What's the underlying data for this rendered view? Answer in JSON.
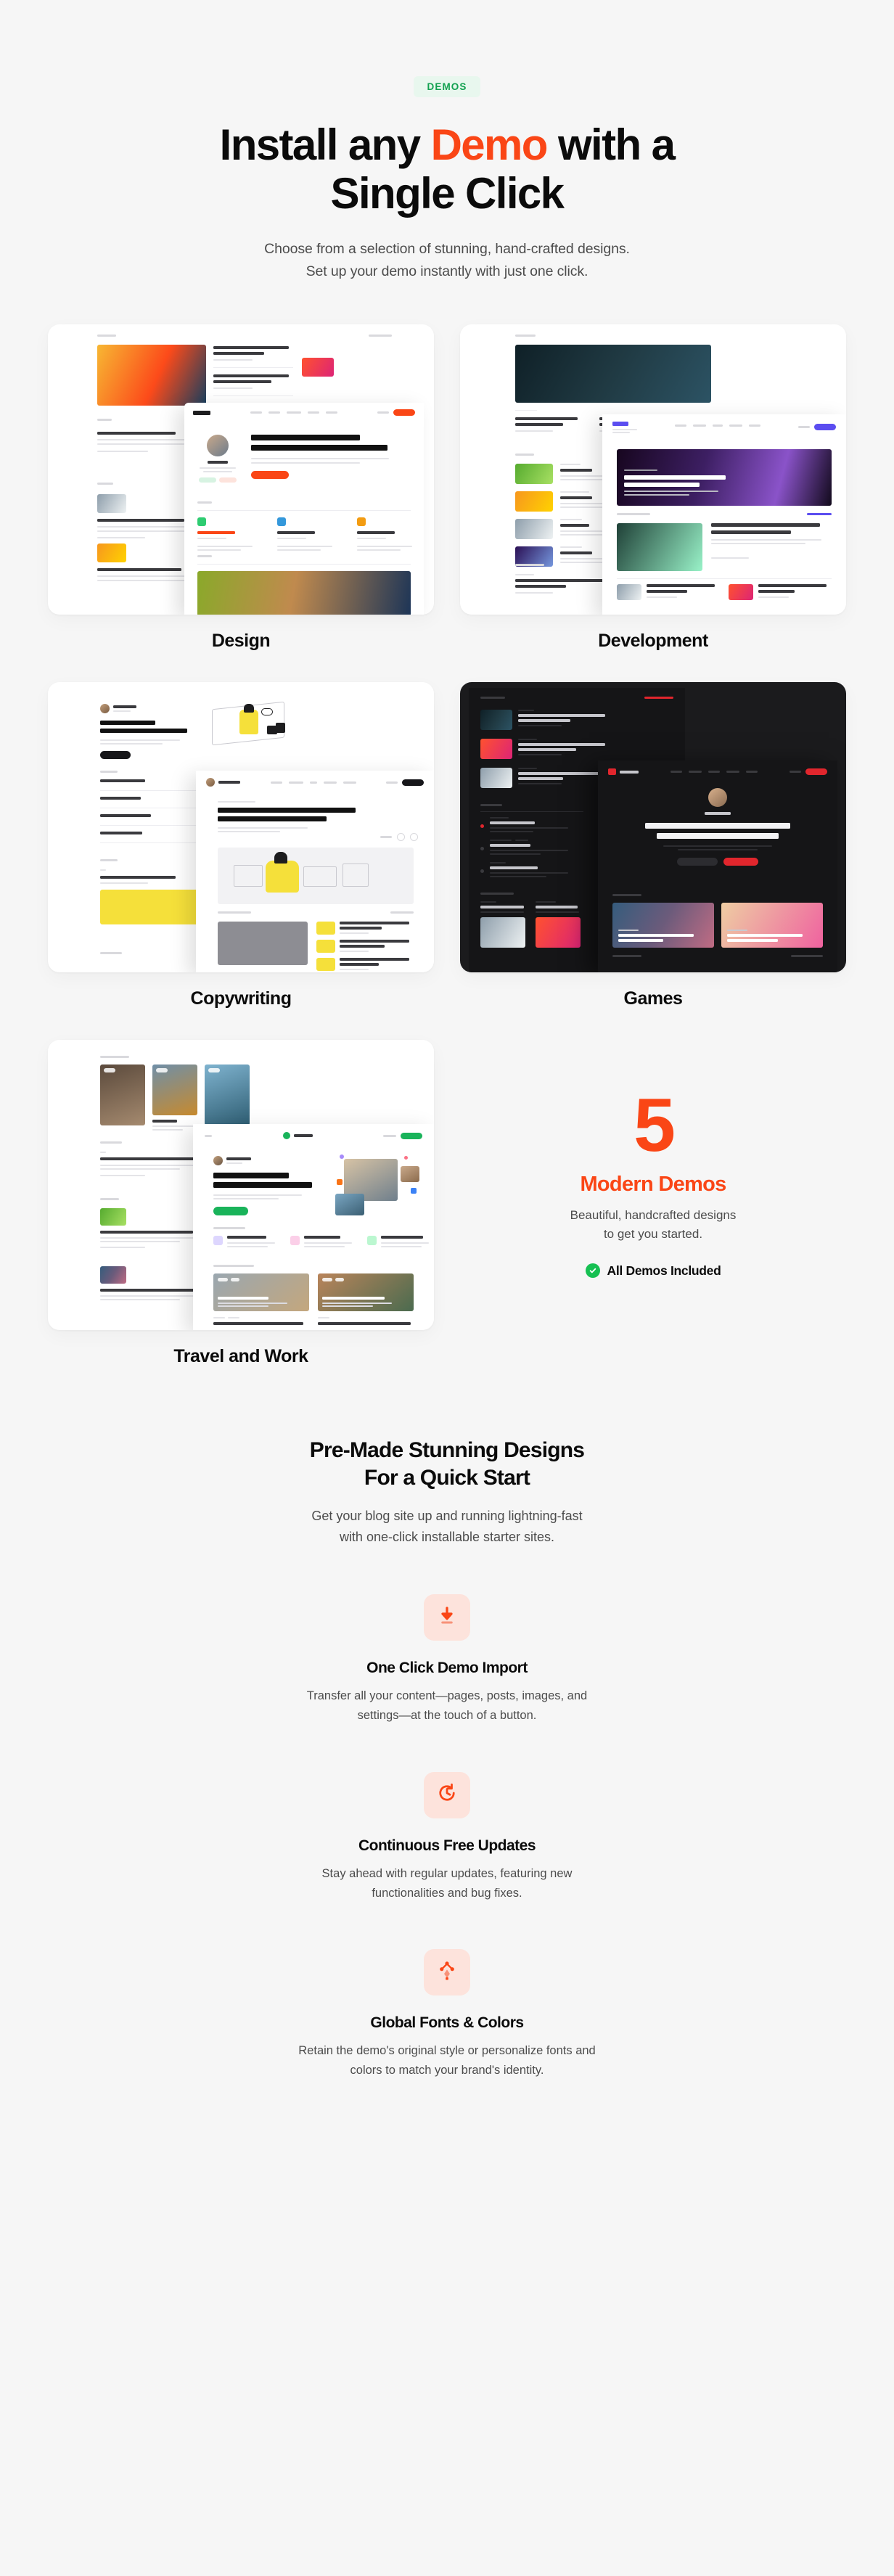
{
  "hero": {
    "badge": "DEMOS",
    "title_part1": "Install any ",
    "title_accent": "Demo",
    "title_part2": " with a",
    "title_line2": "Single Click",
    "subtitle_line1": "Choose from a selection of stunning, hand-crafted designs.",
    "subtitle_line2": "Set up your demo instantly with just one click."
  },
  "colors": {
    "accent": "#fa4616",
    "badge_text": "#12a150",
    "badge_bg": "#e8f7ee",
    "check_green": "#16c052",
    "page_bg": "#f6f6f6",
    "icon_box_bg": "#fde3dc"
  },
  "demos": [
    {
      "label": "Design",
      "theme": "light"
    },
    {
      "label": "Development",
      "theme": "light"
    },
    {
      "label": "Copywriting",
      "theme": "light"
    },
    {
      "label": "Games",
      "theme": "dark"
    },
    {
      "label": "Travel and Work",
      "theme": "light"
    }
  ],
  "stat": {
    "number": "5",
    "title": "Modern Demos",
    "desc_line1": "Beautiful, handcrafted designs",
    "desc_line2": "to get you started.",
    "check_label": "All Demos Included"
  },
  "features_section": {
    "heading_line1": "Pre-Made Stunning Designs",
    "heading_line2": "For a Quick Start",
    "sub_line1": "Get your blog site up and running lightning-fast",
    "sub_line2": "with one-click installable starter sites.",
    "items": [
      {
        "icon": "download-arrow-icon",
        "title": "One Click Demo Import",
        "desc_line1": "Transfer all your content—pages, posts, images, and",
        "desc_line2": "settings—at the touch of a button."
      },
      {
        "icon": "clock-refresh-icon",
        "title": "Continuous Free Updates",
        "desc_line1": "Stay ahead with regular updates, featuring new",
        "desc_line2": "functionalities and bug fixes."
      },
      {
        "icon": "pen-nib-node-icon",
        "title": "Global Fonts & Colors",
        "desc_line1": "Retain the demo's original style or personalize fonts and",
        "desc_line2": "colors to match your brand's identity."
      }
    ]
  }
}
